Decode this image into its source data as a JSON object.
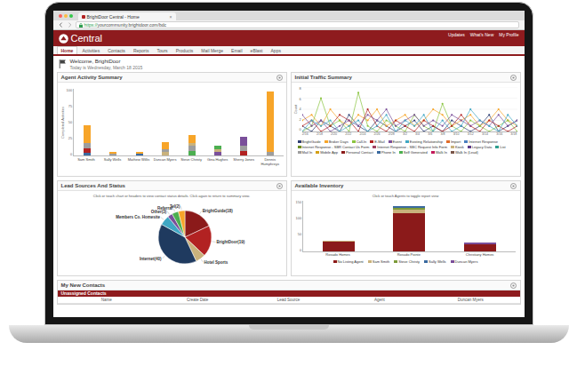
{
  "browser": {
    "tab_title": "BrightDoor Central - Home",
    "tab_close": "×",
    "url_scheme": "https://",
    "url_rest": "yourcommunity.brightdoor.com/bdc"
  },
  "app": {
    "logo": "Central",
    "top_links": [
      "Updates",
      "What's New",
      "My Profile"
    ]
  },
  "tabs": [
    {
      "label": "Home",
      "selected": true
    },
    {
      "label": "Activities",
      "selected": false
    },
    {
      "label": "Contacts",
      "selected": false
    },
    {
      "label": "Reports",
      "selected": false
    },
    {
      "label": "Tours",
      "selected": false
    },
    {
      "label": "Products",
      "selected": false
    },
    {
      "label": "Mail Merge",
      "selected": false
    },
    {
      "label": "Email",
      "selected": false
    },
    {
      "label": "eBlast",
      "selected": false
    },
    {
      "label": "Apps",
      "selected": false
    }
  ],
  "welcome": {
    "title": "Welcome, BrightDoor",
    "date": "Today is Wednesday, March 18 2015"
  },
  "agent_activity": {
    "title": "Agent Activity Summary",
    "y_axis_title": "Completed Activities",
    "y_max": 100,
    "y_ticks": [
      "100",
      "75",
      "50",
      "25",
      "0"
    ],
    "agents": [
      {
        "name": "Sam Smith",
        "segments": [
          {
            "value": 4,
            "color": "#3b6aa0"
          },
          {
            "value": 6,
            "color": "#b22222"
          },
          {
            "value": 8,
            "color": "#9e9e9e"
          },
          {
            "value": 27,
            "color": "#f7a529"
          }
        ]
      },
      {
        "name": "Sally Wells",
        "segments": [
          {
            "value": 2,
            "color": "#9e9e9e"
          },
          {
            "value": 3,
            "color": "#f7a529"
          }
        ]
      },
      {
        "name": "Mathew Willis",
        "segments": [
          {
            "value": 2,
            "color": "#3b6aa0"
          },
          {
            "value": 3,
            "color": "#f7a529"
          }
        ]
      },
      {
        "name": "Duncan Myers",
        "segments": [
          {
            "value": 5,
            "color": "#c9b27c"
          },
          {
            "value": 4,
            "color": "#9e9e9e"
          },
          {
            "value": 11,
            "color": "#f7a529"
          }
        ]
      },
      {
        "name": "Steve Christy",
        "segments": [
          {
            "value": 6,
            "color": "#4caf50"
          },
          {
            "value": 8,
            "color": "#9e9e9e"
          },
          {
            "value": 4,
            "color": "#c9b27c"
          },
          {
            "value": 12,
            "color": "#f7a529"
          }
        ]
      },
      {
        "name": "Gina Hughes",
        "segments": [
          {
            "value": 5,
            "color": "#7a4f9a"
          },
          {
            "value": 4,
            "color": "#c9b27c"
          },
          {
            "value": 6,
            "color": "#4caf50"
          }
        ]
      },
      {
        "name": "Sherry Jones",
        "segments": [
          {
            "value": 6,
            "color": "#b22222"
          },
          {
            "value": 8,
            "color": "#9e9e9e"
          },
          {
            "value": 14,
            "color": "#7a4f9a"
          }
        ]
      },
      {
        "name": "Dennis Humphreys",
        "segments": [
          {
            "value": 5,
            "color": "#9e9e9e"
          },
          {
            "value": 90,
            "color": "#f7a529"
          }
        ]
      }
    ]
  },
  "traffic": {
    "title": "Initial Traffic Summary",
    "y_axis_title": "Count",
    "y_max": 8,
    "y_ticks": [
      "8",
      "6",
      "4",
      "2",
      "0"
    ],
    "x_labels": [
      "2/16",
      "2/18",
      "2/20",
      "2/22",
      "2/24",
      "2/26",
      "2/28",
      "3/2",
      "3/4",
      "3/6",
      "3/8",
      "3/10",
      "3/12",
      "3/14",
      "3/16",
      "3/18"
    ],
    "series": [
      {
        "color": "#2d3e73",
        "values": [
          1,
          0,
          2,
          1,
          0,
          3,
          1,
          0,
          2,
          1,
          0,
          1,
          2,
          0,
          1,
          0,
          2,
          1,
          0,
          1,
          3,
          0,
          1,
          2
        ]
      },
      {
        "color": "#f7a529",
        "values": [
          2,
          3,
          1,
          4,
          2,
          1,
          3,
          2,
          4,
          1,
          2,
          3,
          1,
          2,
          4,
          3,
          1,
          2,
          3,
          1,
          2,
          4,
          2,
          1
        ]
      },
      {
        "color": "#8ac440",
        "values": [
          0,
          1,
          6,
          1,
          2,
          0,
          7,
          1,
          0,
          2,
          1,
          0,
          3,
          1,
          0,
          5,
          1,
          0,
          2,
          1,
          0,
          1,
          2,
          0
        ]
      },
      {
        "color": "#b22222",
        "values": [
          1,
          2,
          0,
          1,
          3,
          2,
          0,
          4,
          1,
          0,
          2,
          1,
          0,
          2,
          1,
          0,
          1,
          3,
          1,
          0,
          2,
          1,
          0,
          1
        ]
      },
      {
        "color": "#7a4f9a",
        "values": [
          3,
          1,
          2,
          0,
          1,
          2,
          1,
          3,
          2,
          4,
          1,
          2,
          3,
          1,
          2,
          1,
          3,
          2,
          1,
          2,
          1,
          3,
          1,
          2
        ]
      },
      {
        "color": "#3fa7c4",
        "values": [
          0,
          2,
          1,
          2,
          0,
          1,
          2,
          0,
          1,
          3,
          0,
          2,
          1,
          3,
          0,
          2,
          0,
          1,
          4,
          2,
          1,
          0,
          3,
          1
        ]
      }
    ],
    "legend": [
      {
        "name": "BrightGuide",
        "color": "#2d3e73"
      },
      {
        "name": "Broker Days",
        "color": "#f7a529"
      },
      {
        "name": "Call-In",
        "color": "#8ac440"
      },
      {
        "name": "E-Mail",
        "color": "#b22222"
      },
      {
        "name": "Event",
        "color": "#7a4f9a"
      },
      {
        "name": "Existing Relationship",
        "color": "#3fa7c4"
      },
      {
        "name": "Import",
        "color": "#e06c2a"
      },
      {
        "name": "Internet Response",
        "color": "#4a7fbf"
      },
      {
        "name": "Internet Response - SBR Contact Us Form",
        "color": "#6b8e23"
      },
      {
        "name": "Internet Response - SBC Request Info Form",
        "color": "#a04060"
      },
      {
        "name": "Kiosk",
        "color": "#c9b27c"
      },
      {
        "name": "Legacy Data",
        "color": "#5b3a8a"
      },
      {
        "name": "List",
        "color": "#2e9e8f"
      },
      {
        "name": "Mail In",
        "color": "#9e9e9e"
      },
      {
        "name": "Mobile App",
        "color": "#d4a017"
      },
      {
        "name": "Personal Contact",
        "color": "#8b1a1a"
      },
      {
        "name": "Phone In",
        "color": "#3b6aa0"
      },
      {
        "name": "Self Generated",
        "color": "#4caf50"
      },
      {
        "name": "Walk In",
        "color": "#c2185b"
      },
      {
        "name": "Walk In (Lead)",
        "color": "#795548"
      }
    ]
  },
  "lead_sources": {
    "title": "Lead Sources And Status",
    "hint": "Click or touch chart or headers to view contact status details. Click again to return to summary view.",
    "slices": [
      {
        "label": "BrightGuide(18)",
        "value": 18,
        "color": "#8b1a1a"
      },
      {
        "label": "BrightDoor(19)",
        "value": 19,
        "color": "#b22222"
      },
      {
        "label": "Hotel Sports",
        "value": 6,
        "color": "#c9b27c"
      },
      {
        "label": "Internet(40)",
        "value": 40,
        "color": "#1f3a5f"
      },
      {
        "label": "Members Co. Homesite",
        "value": 6,
        "color": "#3fa7c4"
      },
      {
        "label": "Other(3)",
        "value": 3,
        "color": "#7a4f9a"
      },
      {
        "label": "Referral",
        "value": 4,
        "color": "#4caf50"
      },
      {
        "label": "Tel(2)",
        "value": 4,
        "color": "#f7a529"
      }
    ]
  },
  "inventory": {
    "title": "Available Inventory",
    "hint": "Click or touch Agents to toggle report view",
    "y_max": 150,
    "y_ticks": [
      "150",
      "100",
      "50",
      "0"
    ],
    "communities": [
      {
        "name": "Rosado Homes",
        "segments": [
          {
            "value": 28,
            "color": "#8b1a1a"
          },
          {
            "value": 4,
            "color": "#c9b27c"
          }
        ]
      },
      {
        "name": "Rosado Pointe",
        "segments": [
          {
            "value": 112,
            "color": "#8b1a1a"
          },
          {
            "value": 10,
            "color": "#c9b27c"
          },
          {
            "value": 6,
            "color": "#7d9b3a"
          },
          {
            "value": 4,
            "color": "#3b6aa0"
          }
        ]
      },
      {
        "name": "Christiany Homes",
        "segments": [
          {
            "value": 22,
            "color": "#8b1a1a"
          },
          {
            "value": 3,
            "color": "#7a4f9a"
          }
        ]
      }
    ],
    "legend": [
      {
        "name": "No Listing Agent",
        "color": "#8b1a1a"
      },
      {
        "name": "Sam Smith",
        "color": "#c9b27c"
      },
      {
        "name": "Steve Christy",
        "color": "#7d9b3a"
      },
      {
        "name": "Sally Wells",
        "color": "#3b6aa0"
      },
      {
        "name": "Duncan Myers",
        "color": "#7a4f9a"
      }
    ]
  },
  "new_contacts": {
    "title": "My New Contacts",
    "section": "Unassigned Contacts",
    "columns": [
      "Name",
      "Create Date",
      "Lead Source",
      "Agent",
      "Duncan Myers"
    ]
  }
}
